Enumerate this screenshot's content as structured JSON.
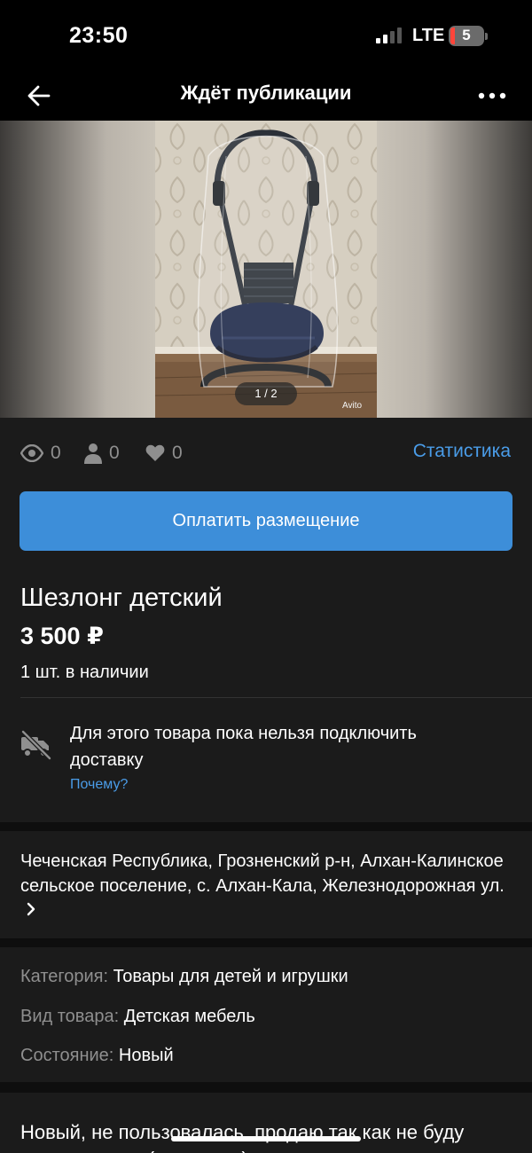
{
  "status_bar": {
    "time": "23:50",
    "network": "LTE",
    "battery": "5"
  },
  "nav": {
    "title": "Ждёт публикации",
    "back_icon": "arrow-left-icon",
    "more_icon": "more-dots-icon"
  },
  "gallery": {
    "page_indicator": "1 / 2",
    "watermark": "Avito"
  },
  "stats": {
    "views": "0",
    "contacts": "0",
    "favorites": "0",
    "link": "Статистика"
  },
  "pay_button": "Оплатить размещение",
  "item": {
    "title": "Шезлонг детский",
    "price": "3 500 ₽",
    "quantity": "1 шт. в наличии"
  },
  "delivery": {
    "text": "Для этого товара пока нельзя подключить доставку",
    "why_link": "Почему?"
  },
  "address": "Чеченская Республика, Грозненский р-н, Алхан-Калинское сельское поселение, с. Алхан-Кала, Железнодорожная ул.",
  "params": [
    {
      "label": "Категория:",
      "value": "Товары для детей и игрушки"
    },
    {
      "label": "Вид товара:",
      "value": "Детская мебель"
    },
    {
      "label": "Состояние:",
      "value": "Новый"
    }
  ],
  "description": "Новый, не пользовалась, продаю так как не буду пользоваться (подарили)",
  "colors": {
    "accent": "#3d8ed9",
    "link": "#4a9ce8",
    "background": "#1b1b1b",
    "muted_text": "#8f8f8f",
    "battery_low": "#ff453a"
  }
}
